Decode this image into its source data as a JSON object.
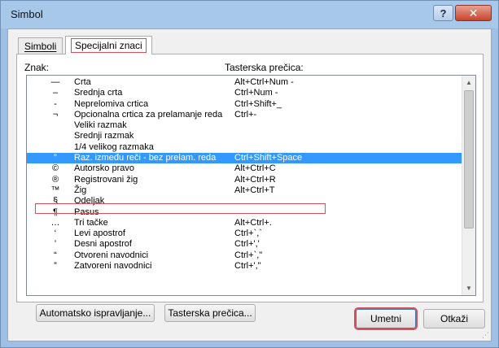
{
  "window": {
    "title": "Simbol",
    "help_label": "?",
    "close_label": "✕"
  },
  "tabs": [
    {
      "label": "Simboli",
      "active": false
    },
    {
      "label": "Specijalni znaci",
      "active": true
    }
  ],
  "list": {
    "header_sign": "Znak:",
    "header_shortcut": "Tasterska prečica:",
    "selected_index": 7,
    "rows": [
      {
        "symbol": "—",
        "name": "Crta",
        "shortcut": "Alt+Ctrl+Num -"
      },
      {
        "symbol": "–",
        "name": "Srednja crta",
        "shortcut": "Ctrl+Num -"
      },
      {
        "symbol": "-",
        "name": "Neprelomiva crtica",
        "shortcut": "Ctrl+Shift+_"
      },
      {
        "symbol": "¬",
        "name": "Opcionalna crtica za prelamanje reda",
        "shortcut": "Ctrl+-"
      },
      {
        "symbol": "",
        "name": "Veliki razmak",
        "shortcut": ""
      },
      {
        "symbol": "",
        "name": "Srednji razmak",
        "shortcut": ""
      },
      {
        "symbol": "",
        "name": "1/4 velikog razmaka",
        "shortcut": ""
      },
      {
        "symbol": "°",
        "name": "Raz. između reči - bez prelam. reda",
        "shortcut": "Ctrl+Shift+Space"
      },
      {
        "symbol": "©",
        "name": "Autorsko pravo",
        "shortcut": "Alt+Ctrl+C"
      },
      {
        "symbol": "®",
        "name": "Registrovani žig",
        "shortcut": "Alt+Ctrl+R"
      },
      {
        "symbol": "™",
        "name": "Žig",
        "shortcut": "Alt+Ctrl+T"
      },
      {
        "symbol": "§",
        "name": "Odeljak",
        "shortcut": ""
      },
      {
        "symbol": "¶",
        "name": "Pasus",
        "shortcut": ""
      },
      {
        "symbol": "…",
        "name": "Tri tačke",
        "shortcut": "Alt+Ctrl+."
      },
      {
        "symbol": "‘",
        "name": "Levi apostrof",
        "shortcut": "Ctrl+`,`"
      },
      {
        "symbol": "’",
        "name": "Desni apostrof",
        "shortcut": "Ctrl+','"
      },
      {
        "symbol": "“",
        "name": "Otvoreni navodnici",
        "shortcut": "Ctrl+`,\""
      },
      {
        "symbol": "”",
        "name": "Zatvoreni navodnici",
        "shortcut": "Ctrl+',\""
      }
    ]
  },
  "buttons": {
    "autocorrect": "Automatsko ispravljanje...",
    "shortcut_key": "Tasterska prečica...",
    "insert": "Umetni",
    "cancel": "Otkaži"
  },
  "scrollbar": {
    "up_icon": "▲",
    "down_icon": "▼"
  }
}
